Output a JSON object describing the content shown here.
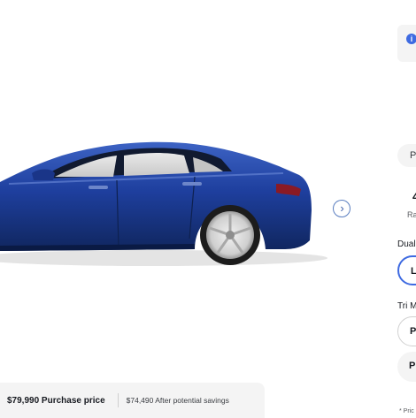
{
  "gallery": {
    "image_label": "Deep Blue Metallic Model S side view",
    "next_icon": "chevron-right-icon",
    "next_glyph": "›"
  },
  "right_panel": {
    "info_icon_glyph": "i",
    "tab_label": "P",
    "stat_value": "4",
    "stat_label": "Ra",
    "section1_label": "Dual",
    "section1_option": "L",
    "section2_label": "Tri M",
    "section2_option1": "P",
    "section2_option2": "P",
    "footnote": "* Pric"
  },
  "price_bar": {
    "purchase_price": "$79,990 Purchase price",
    "savings_price": "$74,490 After potential savings"
  },
  "colors": {
    "accent": "#3e6ae1",
    "car_paint": "#1e3f9e",
    "panel_bg": "#f4f4f4"
  }
}
